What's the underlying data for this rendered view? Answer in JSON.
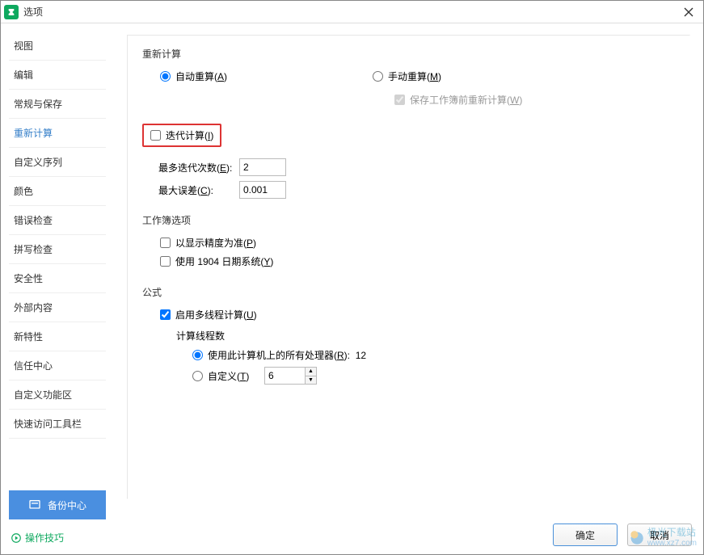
{
  "window": {
    "title": "选项"
  },
  "sidebar": {
    "items": [
      "视图",
      "编辑",
      "常规与保存",
      "重新计算",
      "自定义序列",
      "颜色",
      "错误检查",
      "拼写检查",
      "安全性",
      "外部内容",
      "新特性",
      "信任中心",
      "自定义功能区",
      "快速访问工具栏"
    ],
    "active_index": 3,
    "backup_label": "备份中心",
    "tips_label": "操作技巧"
  },
  "recalc": {
    "group_title": "重新计算",
    "auto": {
      "label": "自动重算(",
      "acc": "A",
      "suffix": ")",
      "checked": true
    },
    "manual": {
      "label": "手动重算(",
      "acc": "M",
      "suffix": ")",
      "checked": false
    },
    "save_recalc": {
      "label": "保存工作簿前重新计算(",
      "acc": "W",
      "suffix": ")",
      "checked": true
    },
    "iterative": {
      "label": "迭代计算(",
      "acc": "I",
      "suffix": ")",
      "checked": false
    },
    "max_iter": {
      "label": "最多迭代次数(",
      "acc": "E",
      "suffix": "):",
      "value": "2"
    },
    "max_err": {
      "label": "最大误差(",
      "acc": "C",
      "suffix": "):",
      "value": "0.001"
    }
  },
  "workbook": {
    "group_title": "工作簿选项",
    "precision": {
      "label": "以显示精度为准(",
      "acc": "P",
      "suffix": ")",
      "checked": false
    },
    "date1904": {
      "label": "使用 1904 日期系统(",
      "acc": "Y",
      "suffix": ")",
      "checked": false
    }
  },
  "formula": {
    "group_title": "公式",
    "multithread": {
      "label": "启用多线程计算(",
      "acc": "U",
      "suffix": ")",
      "checked": true
    },
    "threads_title": "计算线程数",
    "use_all": {
      "label": "使用此计算机上的所有处理器(",
      "acc": "R",
      "suffix": "):",
      "value": "12",
      "checked": true
    },
    "custom": {
      "label": "自定义(",
      "acc": "T",
      "suffix": ")",
      "value": "6",
      "checked": false
    }
  },
  "footer": {
    "ok": "确定",
    "cancel": "取消"
  },
  "watermark": {
    "line1": "极光下载站",
    "line2": "www.xz7.com"
  }
}
